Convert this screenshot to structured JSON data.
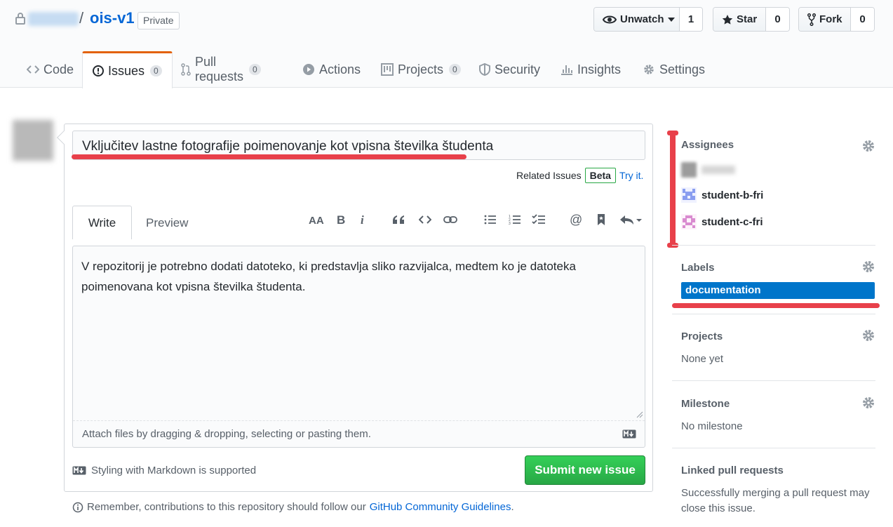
{
  "repo": {
    "name": "ois-v1",
    "separator": "/",
    "visibility": "Private",
    "watch": {
      "label": "Unwatch",
      "count": "1"
    },
    "star": {
      "label": "Star",
      "count": "0"
    },
    "fork": {
      "label": "Fork",
      "count": "0"
    }
  },
  "tabs": [
    {
      "label": "Code",
      "icon": "code-icon"
    },
    {
      "label": "Issues",
      "icon": "issue-icon",
      "count": "0"
    },
    {
      "label": "Pull requests",
      "icon": "pull-request-icon",
      "count": "0"
    },
    {
      "label": "Actions",
      "icon": "play-icon"
    },
    {
      "label": "Projects",
      "icon": "project-icon",
      "count": "0"
    },
    {
      "label": "Security",
      "icon": "shield-icon"
    },
    {
      "label": "Insights",
      "icon": "graph-icon"
    },
    {
      "label": "Settings",
      "icon": "gear-icon"
    }
  ],
  "issue": {
    "title_value": "Vključitev lastne fotografije poimenovanje kot vpisna številka študenta",
    "related_issues_label": "Related Issues",
    "beta_badge": "Beta",
    "try_it_link": "Try it.",
    "write_tab": "Write",
    "preview_tab": "Preview",
    "body": "V repozitorij je potrebno dodati datoteko, ki predstavlja sliko razvijalca, medtem ko je datoteka poimenovana kot vpisna številka študenta.",
    "attach_hint": "Attach files by dragging & dropping, selecting or pasting them.",
    "markdown_note": "Styling with Markdown is supported",
    "submit_label": "Submit new issue",
    "remember_text": "Remember, contributions to this repository should follow our",
    "guidelines_link": "GitHub Community Guidelines",
    "remember_end": "."
  },
  "toolbar": [
    "header-text-icon",
    "bold-icon",
    "italic-icon",
    "quote-icon",
    "code-icon",
    "link-icon",
    "bullet-list-icon",
    "numbered-list-icon",
    "task-list-icon",
    "mention-icon",
    "reference-icon",
    "reply-icon"
  ],
  "sidebar": {
    "assignees": {
      "heading": "Assignees",
      "users": [
        "student-b-fri",
        "student-c-fri"
      ]
    },
    "labels": {
      "heading": "Labels",
      "items": [
        "documentation"
      ],
      "color": "#0075ca"
    },
    "projects": {
      "heading": "Projects",
      "value": "None yet"
    },
    "milestone": {
      "heading": "Milestone",
      "value": "No milestone"
    },
    "linked": {
      "heading": "Linked pull requests",
      "description": "Successfully merging a pull request may close this issue."
    }
  },
  "colors": {
    "accent": "#0366d6",
    "submit": "#28a745",
    "annotation": "#e8404a",
    "active_tab": "#e36209"
  }
}
